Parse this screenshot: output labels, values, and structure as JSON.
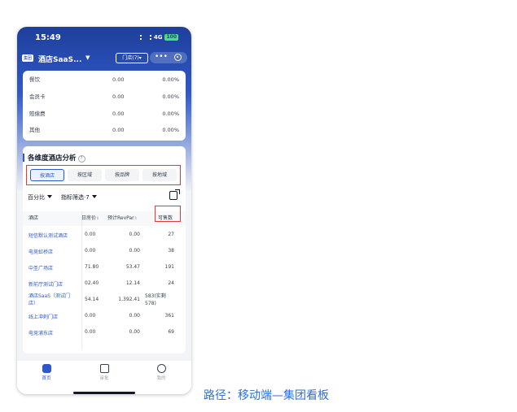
{
  "status": {
    "time": "15:49",
    "network": "4G",
    "battery": "100"
  },
  "header": {
    "badge": "集团",
    "brand": "酒店SaaS...",
    "store_button": "门店(7)▾",
    "more": "•••"
  },
  "payment_rows": [
    {
      "name": "餐饮",
      "value": "0.00",
      "pct": "0.00%"
    },
    {
      "name": "会员卡",
      "value": "0.00",
      "pct": "0.00%"
    },
    {
      "name": "赔偿费",
      "value": "0.00",
      "pct": "0.00%"
    },
    {
      "name": "其他",
      "value": "0.00",
      "pct": "0.00%"
    }
  ],
  "analysis": {
    "title": "各维度酒店分析",
    "help": "?",
    "segments": [
      "按酒店",
      "按区域",
      "按品牌",
      "按地域"
    ],
    "active_segment": 0,
    "filter_1": "百分比",
    "filter_2": "指标筛选·7",
    "columns": [
      "酒店",
      "日房价",
      "预计RevPar",
      "可售数"
    ],
    "rows": [
      {
        "store": "短信默认测试酒店",
        "c1": "0.00",
        "c2": "0.00",
        "c3": "27"
      },
      {
        "store": "电竞虹桥店",
        "c1": "0.00",
        "c2": "0.00",
        "c3": "38"
      },
      {
        "store": "中圣广场店",
        "c1": "71.80",
        "c2": "53.47",
        "c3": "191"
      },
      {
        "store": "新前厅测试门店",
        "c1": "02.40",
        "c2": "12.14",
        "c3": "24"
      },
      {
        "store": "酒店SaaS（测试门店）",
        "c1": "54.14",
        "c2": "1,392.41",
        "c3": "583(实剩578)"
      },
      {
        "store": "线上冲刺门店",
        "c1": "0.00",
        "c2": "0.00",
        "c3": "361"
      },
      {
        "store": "电竞浦东店",
        "c1": "0.00",
        "c2": "0.00",
        "c3": "69"
      }
    ]
  },
  "tabs": [
    "首页",
    "审批",
    "我的"
  ],
  "caption": "路径：移动端—集团看板",
  "colors": {
    "primary": "#2f58c8",
    "highlight": "#e53935",
    "caption": "#2f6fd6"
  }
}
